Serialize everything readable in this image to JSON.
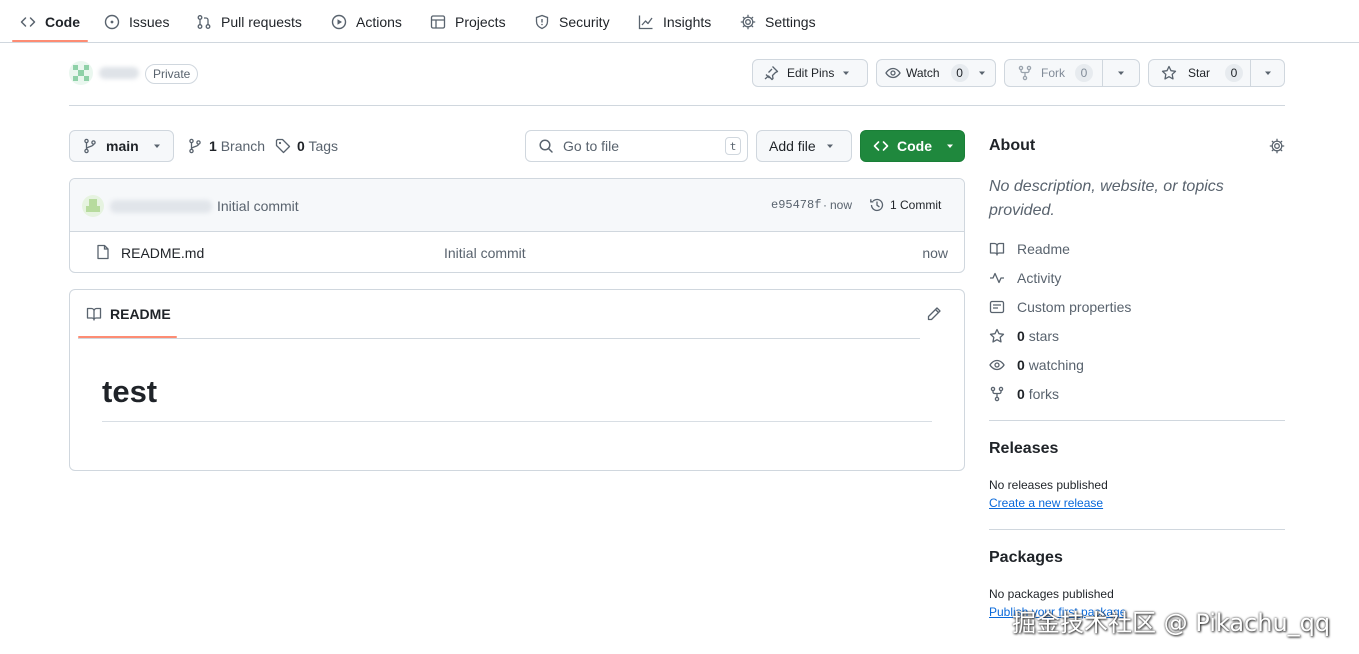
{
  "nav": {
    "tabs": [
      {
        "label": "Code",
        "icon": "code-icon",
        "active": true
      },
      {
        "label": "Issues",
        "icon": "issue-opened-icon"
      },
      {
        "label": "Pull requests",
        "icon": "git-pull-request-icon"
      },
      {
        "label": "Actions",
        "icon": "play-icon"
      },
      {
        "label": "Projects",
        "icon": "table-icon"
      },
      {
        "label": "Security",
        "icon": "shield-icon"
      },
      {
        "label": "Insights",
        "icon": "graph-icon"
      },
      {
        "label": "Settings",
        "icon": "gear-icon"
      }
    ]
  },
  "repo": {
    "visibility": "Private",
    "edit_pins_label": "Edit Pins",
    "watch_label": "Watch",
    "watch_count": "0",
    "fork_label": "Fork",
    "fork_count": "0",
    "star_label": "Star",
    "star_count": "0"
  },
  "toolbar": {
    "branch": "main",
    "branches_count": "1",
    "branches_label": "Branch",
    "tags_count": "0",
    "tags_label": "Tags",
    "search_placeholder": "Go to file",
    "search_shortcut": "t",
    "add_file_label": "Add file",
    "code_label": "Code"
  },
  "latest_commit": {
    "message": "Initial commit",
    "hash": "e95478f",
    "time": "now",
    "separator": "·",
    "commits_label": "1 Commit"
  },
  "files": [
    {
      "name": "README.md",
      "message": "Initial commit",
      "time": "now",
      "icon": "file-icon"
    }
  ],
  "readme": {
    "tab_label": "README",
    "heading": "test"
  },
  "about": {
    "title": "About",
    "description": "No description, website, or topics provided.",
    "items": [
      {
        "icon": "book-icon",
        "label": "Readme",
        "count": ""
      },
      {
        "icon": "pulse-icon",
        "label": "Activity",
        "count": ""
      },
      {
        "icon": "note-icon",
        "label": "Custom properties",
        "count": ""
      },
      {
        "icon": "star-icon",
        "label": "stars",
        "count": "0"
      },
      {
        "icon": "eye-icon",
        "label": "watching",
        "count": "0"
      },
      {
        "icon": "repo-forked-icon",
        "label": "forks",
        "count": "0"
      }
    ]
  },
  "releases": {
    "title": "Releases",
    "empty_text": "No releases published",
    "create_link": "Create a new release"
  },
  "packages": {
    "title": "Packages",
    "empty_text": "No packages published",
    "publish_link": "Publish your first package"
  },
  "watermark": "掘金技术社区 @ Pikachu_qq",
  "colors": {
    "accent_green": "#1f883d",
    "link_blue": "#0969da",
    "active_tab_underline": "#fd8c73",
    "border": "#d0d7de"
  }
}
